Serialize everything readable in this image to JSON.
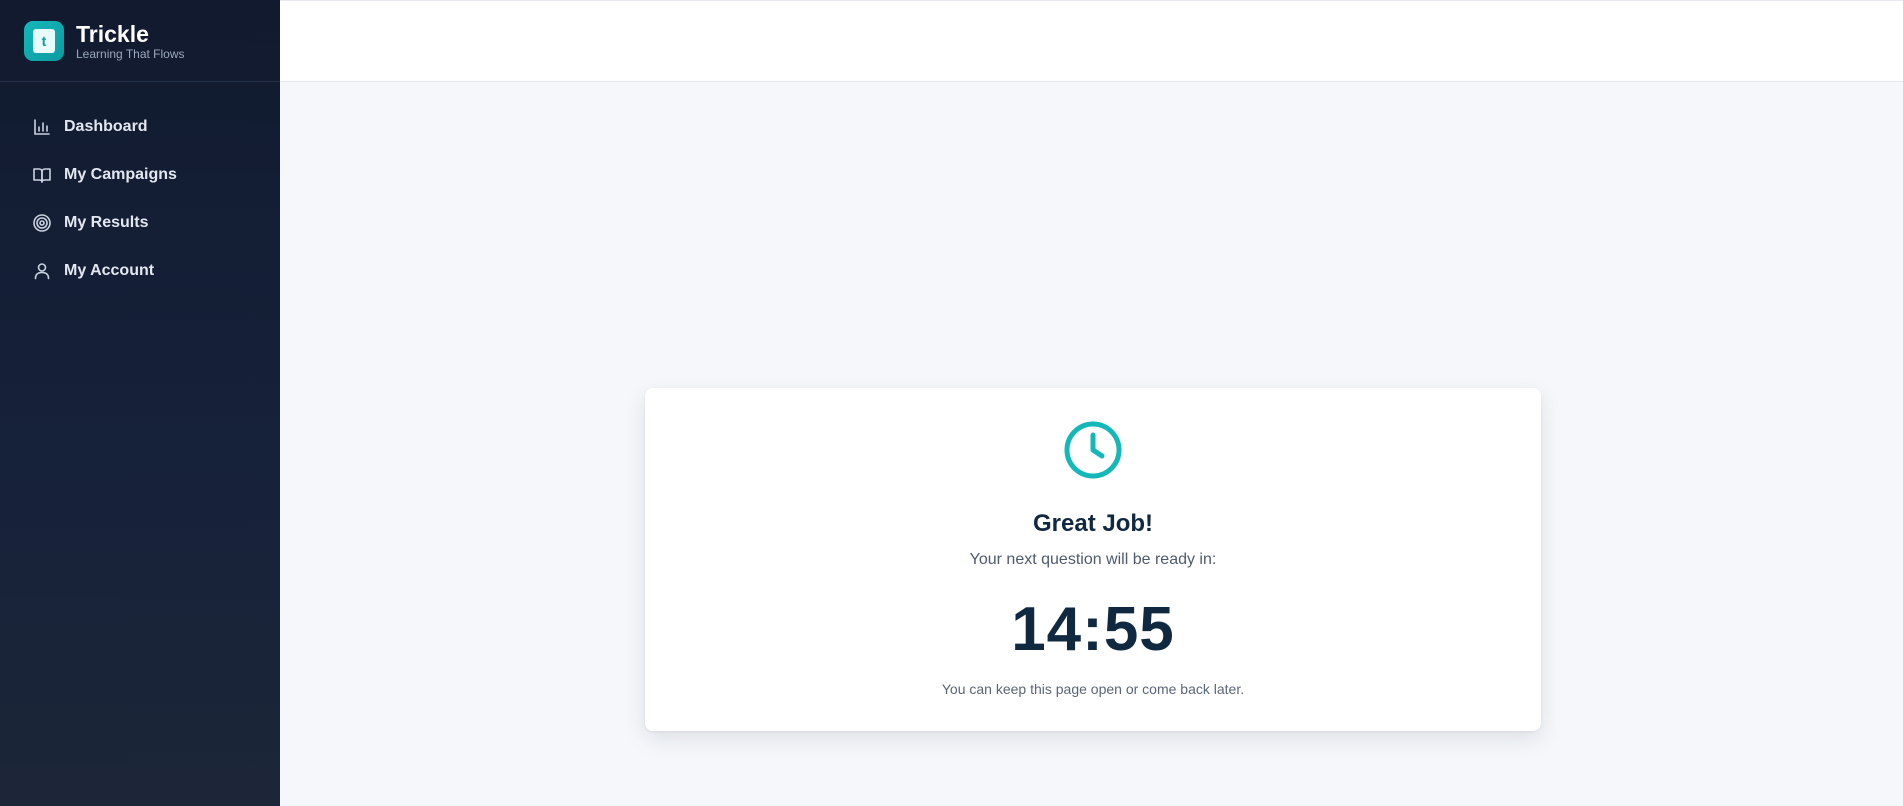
{
  "app": {
    "name": "Trickle",
    "tagline": "Learning That Flows",
    "logo_glyph": "t",
    "accent_color": "#14b8b8"
  },
  "sidebar": {
    "items": [
      {
        "label": "Dashboard",
        "icon": "bar-chart-icon"
      },
      {
        "label": "My Campaigns",
        "icon": "book-open-icon"
      },
      {
        "label": "My Results",
        "icon": "target-icon"
      },
      {
        "label": "My Account",
        "icon": "user-icon"
      }
    ]
  },
  "card": {
    "icon": "clock-icon",
    "title": "Great Job!",
    "subtitle": "Your next question will be ready in:",
    "countdown": "14:55",
    "note": "You can keep this page open or come back later."
  }
}
